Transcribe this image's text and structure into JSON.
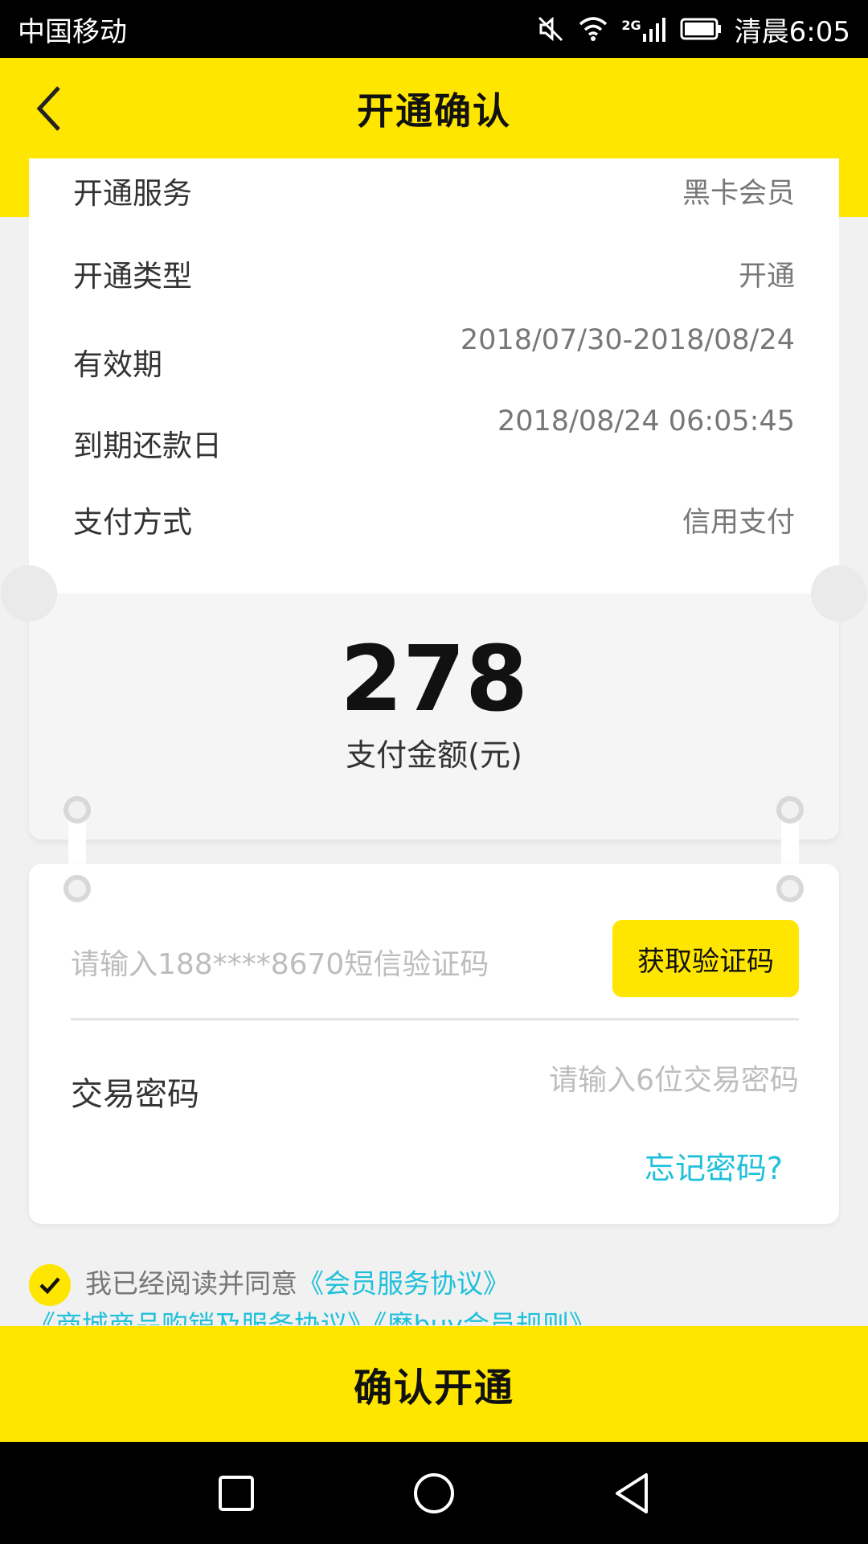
{
  "status_bar": {
    "carrier": "中国移动",
    "network_label": "2G",
    "time": "清晨6:05",
    "icons": [
      "mute-icon",
      "wifi-icon",
      "signal-icon",
      "battery-icon"
    ]
  },
  "header": {
    "title": "开通确认",
    "back_icon": "chevron-left-icon"
  },
  "info": {
    "rows": [
      {
        "label": "开通服务",
        "value": "黑卡会员"
      },
      {
        "label": "开通类型",
        "value": "开通"
      },
      {
        "label": "有效期",
        "value": "2018/07/30-2018/08/24"
      },
      {
        "label": "到期还款日",
        "value": "2018/08/24 06:05:45"
      },
      {
        "label": "支付方式",
        "value": "信用支付"
      }
    ]
  },
  "amount": {
    "value": "278",
    "label": "支付金额(元)"
  },
  "form": {
    "sms_placeholder": "请输入188****8670短信验证码",
    "get_code_label": "获取验证码",
    "password_label": "交易密码",
    "password_placeholder": "请输入6位交易密码",
    "forgot_label": "忘记密码?"
  },
  "agreement": {
    "checked": true,
    "text": "我已经阅读并同意",
    "links": [
      "《会员服务协议》",
      "《商城商品购销及服务协议》",
      "《麽buy会员规则》"
    ]
  },
  "confirm_label": "确认开通",
  "nav": {
    "icons": [
      "recent-apps-icon",
      "home-icon",
      "back-triangle-icon"
    ]
  },
  "colors": {
    "accent": "#ffe600",
    "link": "#1fc0da",
    "background": "#f1f1f1"
  }
}
